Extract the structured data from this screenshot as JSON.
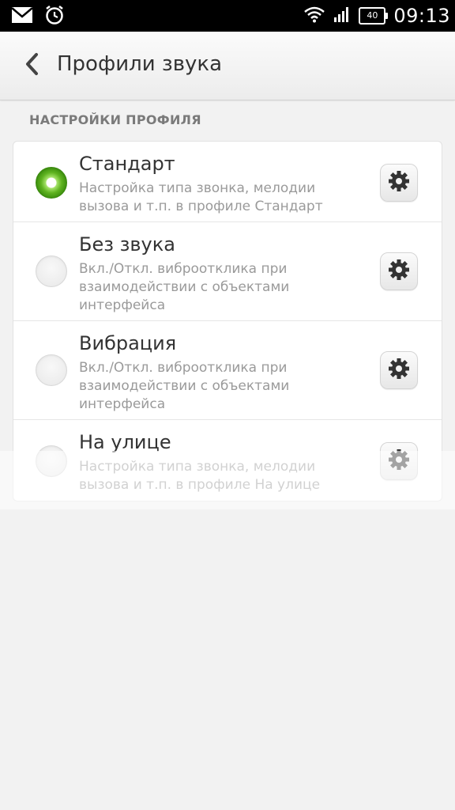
{
  "status_bar": {
    "time": "09:13",
    "battery": "40",
    "icons": [
      "mail-icon",
      "alarm-icon",
      "wifi-icon",
      "signal-icon",
      "battery-icon"
    ]
  },
  "header": {
    "title": "Профили звука",
    "back_icon": "chevron-left-icon"
  },
  "section": {
    "title": "НАСТРОЙКИ ПРОФИЛЯ"
  },
  "profiles": [
    {
      "title": "Стандарт",
      "subtitle": "Настройка типа звонка, мелодии вызова и т.п. в профиле Стандарт",
      "selected": true
    },
    {
      "title": "Без звука",
      "subtitle": "Вкл./Откл. виброотклика при взаимодействии с объектами интерфейса",
      "selected": false
    },
    {
      "title": "Вибрация",
      "subtitle": "Вкл./Откл. виброотклика при взаимодействии с объектами интерфейса",
      "selected": false
    },
    {
      "title": "На улице",
      "subtitle": "Настройка типа звонка, мелодии вызова и т.п. в профиле На улице",
      "selected": false
    }
  ],
  "colors": {
    "accent": "#5fb320",
    "background": "#f2f2f2"
  }
}
